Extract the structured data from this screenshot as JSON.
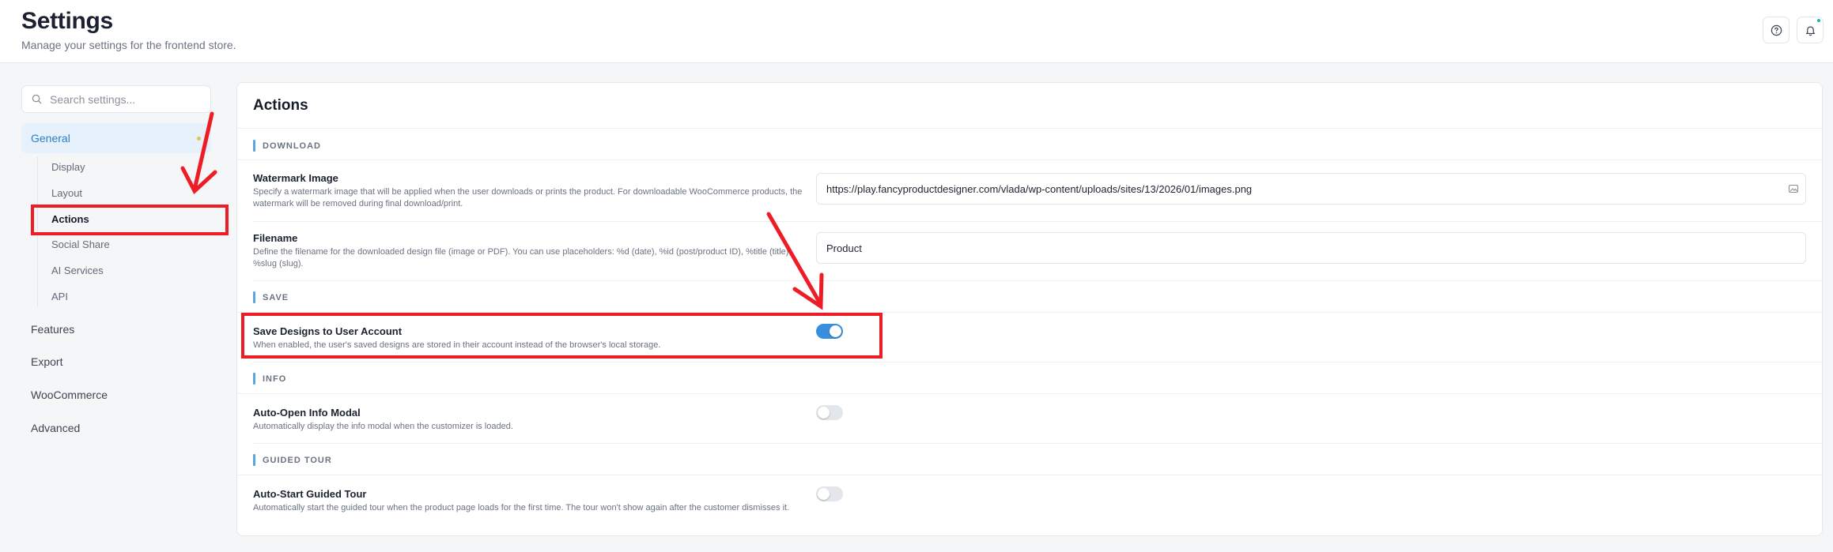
{
  "header": {
    "title": "Settings",
    "subtitle": "Manage your settings for the frontend store.",
    "help_icon": "help-circle-icon",
    "bell_icon": "bell-icon"
  },
  "sidebar": {
    "search_placeholder": "Search settings...",
    "active_group": "General",
    "general_subitems": [
      "Display",
      "Layout",
      "Actions",
      "Social Share",
      "AI Services",
      "API"
    ],
    "active_subitem": "Actions",
    "groups": [
      "Features",
      "Export",
      "WooCommerce",
      "Advanced"
    ]
  },
  "main": {
    "title": "Actions",
    "sections": {
      "download": "DOWNLOAD",
      "save": "SAVE",
      "info": "INFO",
      "guided_tour": "GUIDED TOUR"
    },
    "watermark": {
      "label": "Watermark Image",
      "desc": "Specify a watermark image that will be applied when the user downloads or prints the product. For downloadable WooCommerce products, the watermark will be removed during final download/print.",
      "value": "https://play.fancyproductdesigner.com/vlada/wp-content/uploads/sites/13/2026/01/images.png"
    },
    "filename": {
      "label": "Filename",
      "desc": "Define the filename for the downloaded design file (image or PDF). You can use placeholders: %d (date), %id (post/product ID), %title (title), %slug (slug).",
      "value": "Product"
    },
    "save_designs": {
      "label": "Save Designs to User Account",
      "desc": "When enabled, the user's saved designs are stored in their account instead of the browser's local storage.",
      "enabled": true
    },
    "auto_open_info": {
      "label": "Auto-Open Info Modal",
      "desc": "Automatically display the info modal when the customizer is loaded.",
      "enabled": false
    },
    "auto_start_tour": {
      "label": "Auto-Start Guided Tour",
      "desc": "Automatically start the guided tour when the product page loads for the first time. The tour won't show again after the customer dismisses it.",
      "enabled": false
    }
  },
  "colors": {
    "accent": "#3a8fdc",
    "annotation": "#ee1c24"
  }
}
